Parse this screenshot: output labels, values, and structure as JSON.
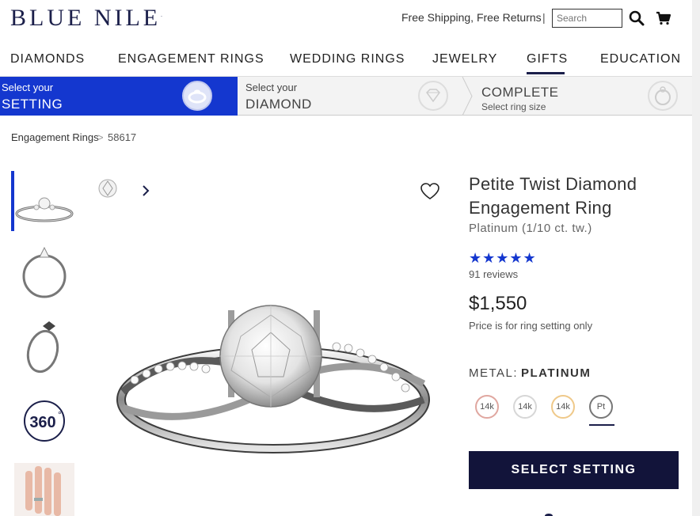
{
  "header": {
    "logo": "BLUE NILE",
    "logo_mark": ".",
    "shipping": "Free Shipping, Free Returns",
    "separator": "|",
    "search_placeholder": "Search"
  },
  "nav": {
    "items": [
      "DIAMONDS",
      "ENGAGEMENT RINGS",
      "WEDDING RINGS",
      "JEWELRY",
      "GIFTS",
      "EDUCATION"
    ],
    "active": "GIFTS"
  },
  "steps": {
    "setting": {
      "small": "Select your",
      "big": "SETTING"
    },
    "diamond": {
      "small": "Select your",
      "big": "DIAMOND"
    },
    "complete": {
      "big": "COMPLETE",
      "small": "Select ring size"
    },
    "colors": {
      "active": "#1437cf",
      "inactive": "#f3f3f3"
    }
  },
  "breadcrumb": {
    "parent": "Engagement Rings",
    "separator": ">",
    "current": "58617"
  },
  "gallery": {
    "thumbnails": [
      "ring-angle-view",
      "ring-side-view",
      "ring-profile-view",
      "360-view",
      "hand-view"
    ],
    "badge_360": "360",
    "badge_360_deg": "°",
    "next_arrow": "chevron-right-icon"
  },
  "product": {
    "title": "Petite Twist Diamond Engagement Ring",
    "subtitle": "Platinum (1/10 ct. tw.)",
    "stars": "★★★★★",
    "rating": 5,
    "reviews": "91 reviews",
    "price": "$1,550",
    "price_note": "Price is for ring setting only",
    "metal_label": "METAL:",
    "metal_value": "PLATINUM",
    "metals": [
      {
        "label": "14k",
        "color": "#e0a7a0"
      },
      {
        "label": "14k",
        "color": "#d7d7d7"
      },
      {
        "label": "14k",
        "color": "#efc98a"
      },
      {
        "label": "Pt",
        "color": "#777777"
      }
    ],
    "cta": "SELECT SETTING"
  },
  "colors": {
    "brand_navy": "#12143a",
    "accent_blue": "#1437cf"
  }
}
